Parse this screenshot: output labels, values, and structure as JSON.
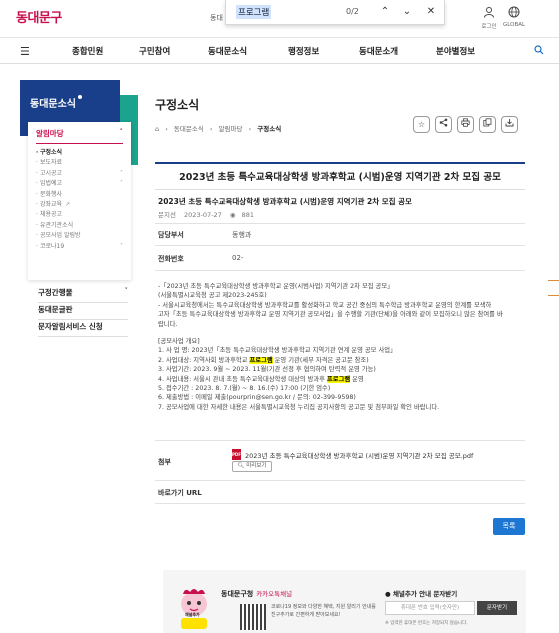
{
  "header": {
    "logo": "동대문구",
    "logo_small": "동대",
    "login_label": "로그인",
    "global_label": "GLOBAL"
  },
  "findbar": {
    "query": "프로그램",
    "count": "0/2"
  },
  "gnb": {
    "items": [
      "종합민원",
      "구민참여",
      "동대문소식",
      "행정정보",
      "동대문소개",
      "분야별정보"
    ]
  },
  "sidebar": {
    "title": "동대문소식",
    "section": "알림마당",
    "sub_items": [
      "구정소식",
      "보도자료",
      "고시공고",
      "입법예고",
      "문화행사",
      "강좌교육",
      "채용공고",
      "유관기관소식",
      "공모사업 알림방",
      "코로나19"
    ],
    "sub_chevrons": [
      "",
      "",
      "˅",
      "˅",
      "",
      "↗",
      "",
      "",
      "",
      "˅"
    ],
    "main_items": [
      "구정간행물",
      "동대문글판",
      "문자알림서비스 신청"
    ]
  },
  "page": {
    "title": "구정소식",
    "breadcrumb": [
      "⌂",
      "동대문소식",
      "알림마당",
      "구정소식"
    ]
  },
  "post": {
    "title": "2023년 초등 특수교육대상학생 방과후학교 (시범)운영 지역기관 2차 모집 공모",
    "subtitle": "2023년 초등 특수교육대상학생 방과후학교 (시범)운영 지역기관 2차 모집 공모",
    "author": "문지선",
    "date": "2023-07-27",
    "views": "881",
    "dept_label": "담당부서",
    "dept_value": "동행과",
    "phone_label": "전화번호",
    "phone_value": "02-",
    "body": [
      "-「2023년 초등 특수교육대상학생 방과후학교 운영(시범사업) 지역기관 2차 모집 공모」",
      "  (서울특별시교육청 공고 제2023-245호)",
      "- 서울시교육청에서는 특수교육대상학생 방과후학교를 활성화하고 학교 공간 중심의 특수학급 방과후학교 운영의 한계를 모색하",
      "고자「초등 특수교육대상학생 방과후학교 운영 지역기관 공모사업」을 수행할 기관(단체)을 아래와 같이 모집하오니 많은 참여를 바",
      "랍니다.",
      "",
      "[공모사업 개요]",
      "1. 사 업 명: 2023년「초등 특수교육대상학생 방과후학교 지역기관 연계 운영 공모 사업」",
      "2. 사업대상: 지역사회 방과후학교 |프로그램| 운영 기관(세부 자격은 공고문 참조)",
      "3. 사업기간: 2023. 9월 ~ 2023. 11월(기관 선정 후 협의하여 탄력적 운영 가능)",
      "4. 사업내용: 서울시 관내 초등 특수교육대상학생 대상의 방과후 |프로그램| 운영",
      "5. 접수기간 : 2023. 8. 7.(월) ~ 8. 16.(수) 17:00 (기한 엄수)",
      "6. 제출방법 : 이메일 제출(pourprin@sen.go.kr / 문의: 02-399-9598)",
      "7. 공모사업에 대한 자세한 내용은 서울특별시교육청 누리집 공지사항의 공고문 및 첨부파일 확인 바랍니다."
    ],
    "attach_label": "첨부",
    "attach_name": "2023년 초등 특수교육대상학생 방과후학교 (시범)운영 지역기관 2차 모집 공모.pdf",
    "preview_label": "미리보기",
    "shortcut_label": "바로가기 URL",
    "list_button": "목록"
  },
  "banner": {
    "brand": "동대문구청",
    "brand_sub": "카카오톡채널",
    "mascot_badge": "채널추가",
    "text": "코로나19 정보와 다양한 혜택, 지원 알리기 안내를 친구추가로 간편하게 받아보세요!",
    "sms_title": "채널추가 안내 문자받기",
    "sms_placeholder": "휴대폰 번호 입력(숫자만)",
    "sms_button": "문자받기",
    "sms_note": "※ 입력한 휴대폰 번호는 저장되지 않습니다."
  }
}
